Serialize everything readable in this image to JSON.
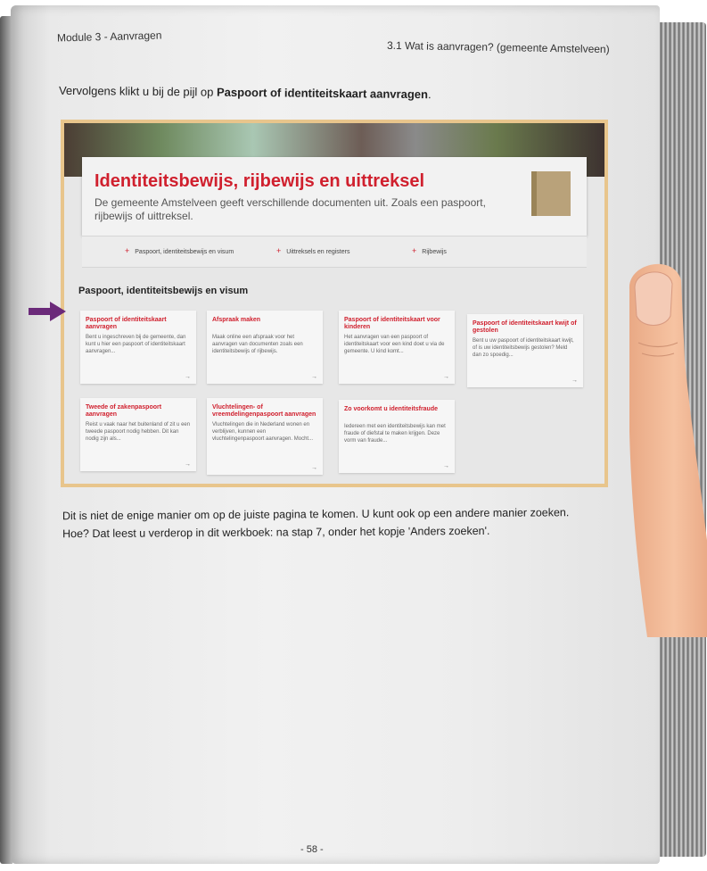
{
  "header": {
    "module": "Module 3 - Aanvragen",
    "section": "3.1 Wat is aanvragen? (gemeente Amstelveen)"
  },
  "intro": {
    "prefix": "Vervolgens klikt u bij de pijl op ",
    "link": "Paspoort of identiteitskaart aanvragen",
    "suffix": "."
  },
  "screenshot": {
    "title": "Identiteitsbewijs, rijbewijs en uittreksel",
    "text": "De gemeente Amstelveen geeft verschillende documenten uit. Zoals een paspoort, rijbewijs of uittreksel.",
    "links": [
      "Paspoort, identiteitsbewijs en visum",
      "Uittreksels en registers",
      "Rijbewijs"
    ],
    "section_title": "Paspoort, identiteitsbewijs en visum",
    "tiles": [
      {
        "title": "Paspoort of identiteitskaart aanvragen",
        "text": "Bent u ingeschreven bij de gemeente, dan kunt u hier een paspoort of identiteitskaart aanvragen..."
      },
      {
        "title": "Afspraak maken",
        "text": "Maak online een afspraak voor het aanvragen van documenten zoals een identiteitsbewijs of rijbewijs."
      },
      {
        "title": "Paspoort of identiteitskaart voor kinderen",
        "text": "Het aanvragen van een paspoort of identiteitskaart voor een kind doet u via de gemeente. U kind komt..."
      },
      {
        "title": "Paspoort of identiteitskaart kwijt of gestolen",
        "text": "Bent u uw paspoort of identiteitskaart kwijt, of is uw identiteitsbewijs gestolen? Meld dan zo spoedig..."
      },
      {
        "title": "Tweede of zakenpaspoort aanvragen",
        "text": "Reist u vaak naar het buitenland of zit u een tweede paspoort nodig hebben. Dit kan nodig zijn als..."
      },
      {
        "title": "Vluchtelingen- of vreemdelingenpaspoort aanvragen",
        "text": "Vluchtelingen die in Nederland wonen en verblijven, kunnen een vluchtelingenpaspoort aanvragen. Mocht..."
      },
      {
        "title": "Zo voorkomt u identiteitsfraude",
        "text": "Iedereen met een identiteitsbewijs kan met fraude of diefstal te maken krijgen. Deze vorm van fraude..."
      }
    ]
  },
  "after": {
    "line1": "Dit is niet de enige manier om op de juiste pagina te komen. U kunt ook op een andere manier zoeken.",
    "line2": "Hoe? Dat leest u verderop in dit werkboek: na stap 7, onder het kopje 'Anders zoeken'."
  },
  "page_number": "- 58 -",
  "colors": {
    "accent_red": "#d0202e",
    "frame": "#e8c58c",
    "arrow": "#6b2a7a"
  }
}
